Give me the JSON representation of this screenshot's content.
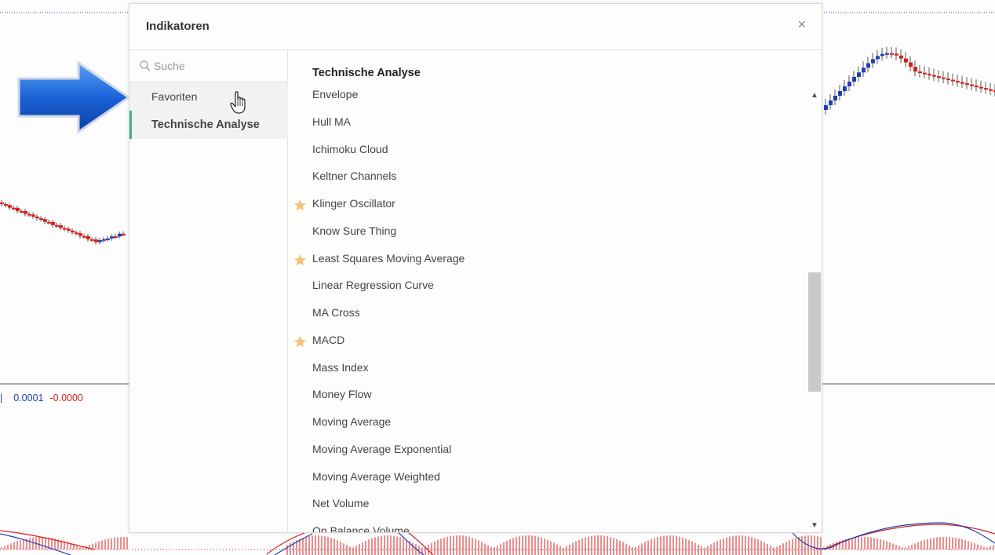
{
  "dialog": {
    "title": "Indikatoren",
    "close_label": "×"
  },
  "sidebar": {
    "search_placeholder": "Suche",
    "items": [
      {
        "label": "Favoriten",
        "active": false
      },
      {
        "label": "Technische Analyse",
        "active": true
      }
    ]
  },
  "content": {
    "heading": "Technische Analyse",
    "indicators": [
      {
        "label": "Envelope",
        "favorite": false
      },
      {
        "label": "Hull MA",
        "favorite": false
      },
      {
        "label": "Ichimoku Cloud",
        "favorite": false
      },
      {
        "label": "Keltner Channels",
        "favorite": false
      },
      {
        "label": "Klinger Oscillator",
        "favorite": true
      },
      {
        "label": "Know Sure Thing",
        "favorite": false
      },
      {
        "label": "Least Squares Moving Average",
        "favorite": true
      },
      {
        "label": "Linear Regression Curve",
        "favorite": false
      },
      {
        "label": "MA Cross",
        "favorite": false
      },
      {
        "label": "MACD",
        "favorite": true
      },
      {
        "label": "Mass Index",
        "favorite": false
      },
      {
        "label": "Money Flow",
        "favorite": false
      },
      {
        "label": "Moving Average",
        "favorite": false
      },
      {
        "label": "Moving Average Exponential",
        "favorite": false
      },
      {
        "label": "Moving Average Weighted",
        "favorite": false
      },
      {
        "label": "Net Volume",
        "favorite": false
      },
      {
        "label": "On Balance Volume",
        "favorite": false
      }
    ],
    "scroll_position": 0.55
  },
  "chart": {
    "macd_value_1": "0.0001",
    "macd_value_2": "-0.0000",
    "up_color": "#1f3fb5",
    "down_color": "#d62020"
  },
  "colors": {
    "accent": "#4caf82",
    "star": "#f5c27a"
  }
}
